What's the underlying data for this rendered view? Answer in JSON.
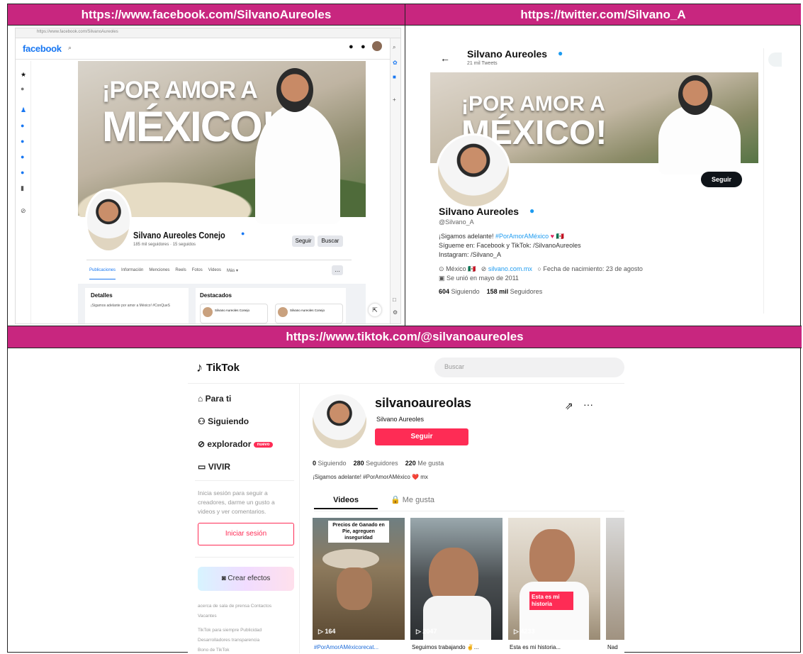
{
  "facebook": {
    "url": "https://www.facebook.com/SilvanoAureoles",
    "address_bar": "https://www.facebook.com/SilvanoAureoles",
    "logo": "facebook",
    "cover_text_line1": "¡POR AMOR A",
    "cover_text_line2": "MÉXICO!",
    "profile_name": "Silvano Aureoles Conejo",
    "profile_stats": "185 mil seguidores · 15 seguidos",
    "follow_button": "Seguir",
    "search_button": "Buscar",
    "tabs": [
      "Publicaciones",
      "Información",
      "Menciones",
      "Reels",
      "Fotos",
      "Videos",
      "Más ▾"
    ],
    "details_title": "Detalles",
    "details_text": "¡Sigamos adelante por amor a México! #ConQueS",
    "featured_title": "Destacados",
    "featured_items": [
      "Silvano Aureoles Conejo",
      "Silvano Aureoles Conejo"
    ]
  },
  "twitter": {
    "url": "https://twitter.com/Silvano_A",
    "header_name": "Silvano Aureoles",
    "header_count": "21 mil Tweets",
    "follow_button": "Seguir",
    "name": "Silvano Aureoles",
    "handle": "@Silvano_A",
    "bio_line1_text": "¡Sigamos adelante! ",
    "bio_line1_hashtag": "#PorAmorAMéxico",
    "bio_line2": "Sígueme en: Facebook y TikTok: /SilvanoAureoles",
    "bio_line3": "Instagram: /Silvano_A",
    "location": "México",
    "website": "silvano.com.mx",
    "birthday": "Fecha de nacimiento: 23 de agosto",
    "joined": "Se unió en mayo de 2011",
    "following_count": "604",
    "following_label": "Siguiendo",
    "followers_count": "158 mil",
    "followers_label": "Seguidores"
  },
  "tiktok": {
    "url": "https://www.tiktok.com/@silvanoaureoles",
    "logo": "TikTok",
    "search_placeholder": "Buscar",
    "nav": [
      "Para ti",
      "Siguiendo",
      "explorador",
      "VIVIR"
    ],
    "nav_badge": "nuevo",
    "login_prompt": "Inicia sesión para seguir a creadores, darme un gusto a videos y ver comentarios.",
    "login_button": "Iniciar sesión",
    "effects_button": "Crear efectos",
    "footer_line1": "acerca de  sala de prensa  Contactos",
    "footer_line2": "Vacantes",
    "footer_line3": "TikTok para siempre  Publicidad",
    "footer_line4": "Desarrolladores  transparencia",
    "footer_line5": "Bono de TikTok",
    "username": "silvanoaureolas",
    "display_name": "Silvano Aureoles",
    "follow_button": "Seguir",
    "following_count": "0",
    "following_label": "Siguiendo",
    "followers_count": "280",
    "followers_label": "Seguidores",
    "likes_count": "220",
    "likes_label": "Me gusta",
    "bio": "¡Sigamos adelante! #PorAmorAMéxico ❤️ mx",
    "tab_videos": "Videos",
    "tab_likes": "Me gusta",
    "videos": [
      {
        "overlay": "Precios de Ganado en Pie, agreguen inseguridad",
        "views": "164",
        "caption": "#PorAmorAMéxicorecat..."
      },
      {
        "overlay": "",
        "views": "2047",
        "caption": "Seguimos trabajando ✌..."
      },
      {
        "overlay": "Esta es mi historia",
        "views": "4233",
        "caption": "Esta es mi historia..."
      },
      {
        "overlay": "",
        "views": "",
        "caption": "Nad"
      }
    ]
  },
  "colors": {
    "header_bg": "#c8267f",
    "twitter_blue": "#1d9bf0",
    "tiktok_red": "#fe2c55",
    "facebook_blue": "#1877f2"
  }
}
